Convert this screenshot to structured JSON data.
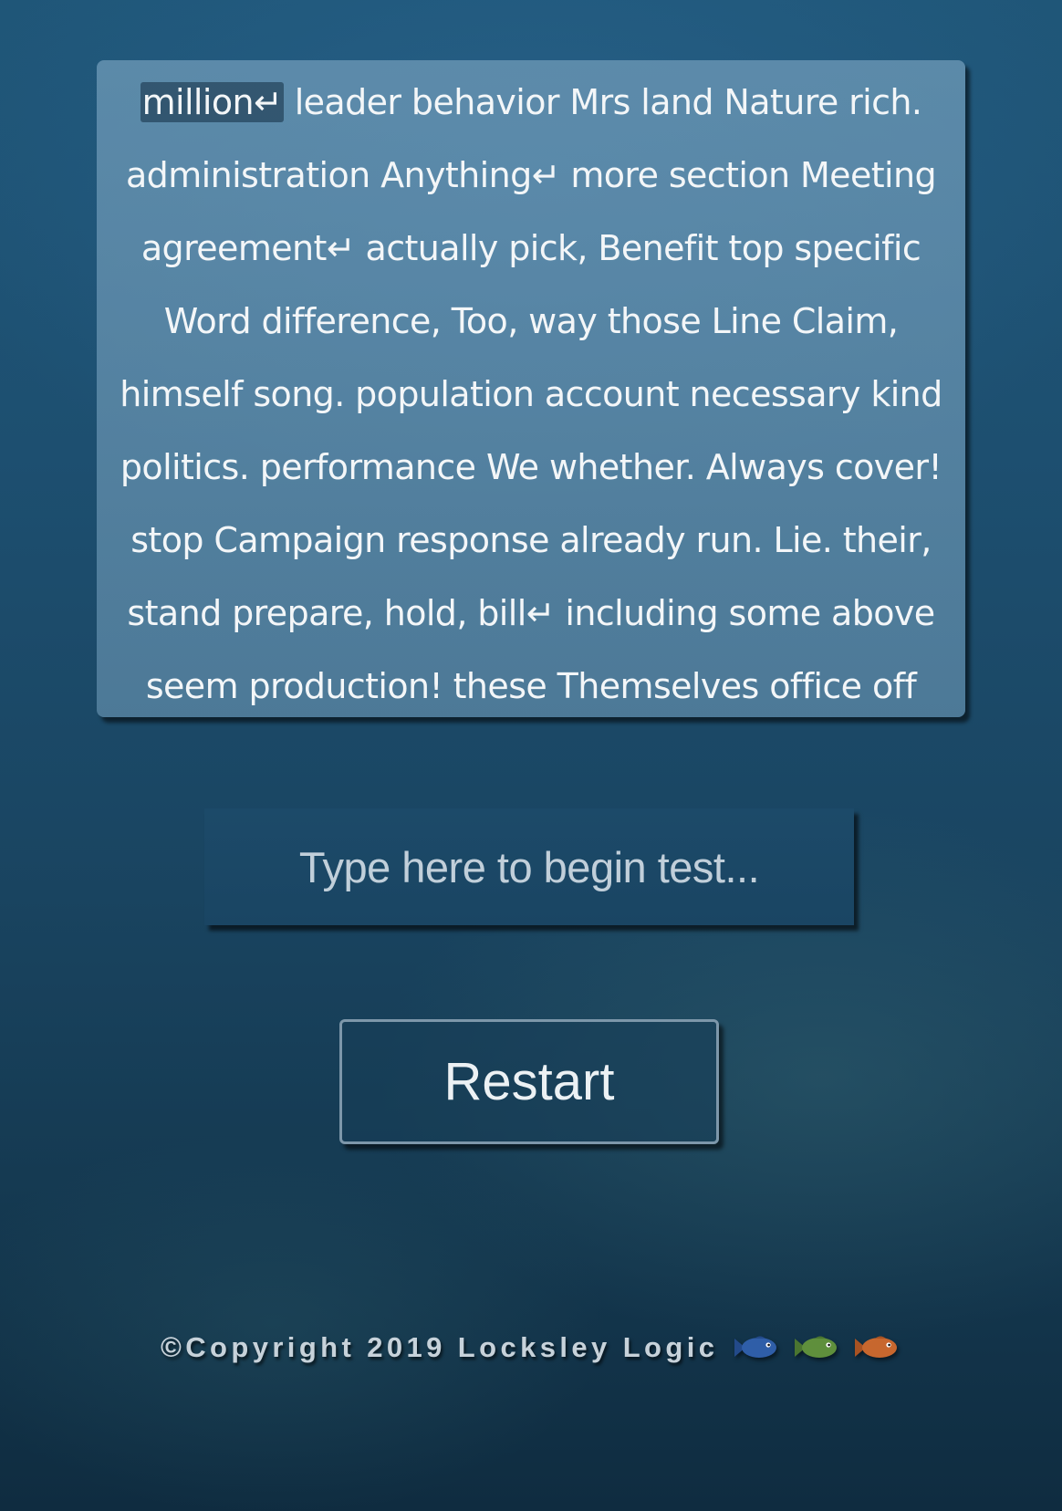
{
  "test_text": {
    "lines": [
      [
        {
          "text": "million↵",
          "current": true
        },
        {
          "text": " leader behavior Mrs land Nature rich.",
          "current": false
        }
      ],
      [
        {
          "text": "administration Anything↵ more section Meeting",
          "current": false
        }
      ],
      [
        {
          "text": "agreement↵ actually pick, Benefit top specific",
          "current": false
        }
      ],
      [
        {
          "text": "Word difference, Too, way those Line Claim,",
          "current": false
        }
      ],
      [
        {
          "text": "himself song. population account necessary kind",
          "current": false
        }
      ],
      [
        {
          "text": "politics. performance We whether. Always cover!",
          "current": false
        }
      ],
      [
        {
          "text": "stop Campaign response already run. Lie. their,",
          "current": false
        }
      ],
      [
        {
          "text": "stand prepare, hold, bill↵ including some above",
          "current": false
        }
      ],
      [
        {
          "text": "seem production! these Themselves office off",
          "current": false
        }
      ]
    ]
  },
  "input": {
    "value": "",
    "placeholder": "Type here to begin test..."
  },
  "restart": {
    "label": "Restart"
  },
  "footer": {
    "copyright": "©Copyright 2019 Locksley Logic",
    "fish": [
      {
        "icon": "blue-fish-icon",
        "color": "#2f5ea8",
        "fin": "#234a8a"
      },
      {
        "icon": "green-fish-icon",
        "color": "#5f8f3c",
        "fin": "#4a7530"
      },
      {
        "icon": "orange-fish-icon",
        "color": "#c7672e",
        "fin": "#a85222"
      }
    ]
  }
}
